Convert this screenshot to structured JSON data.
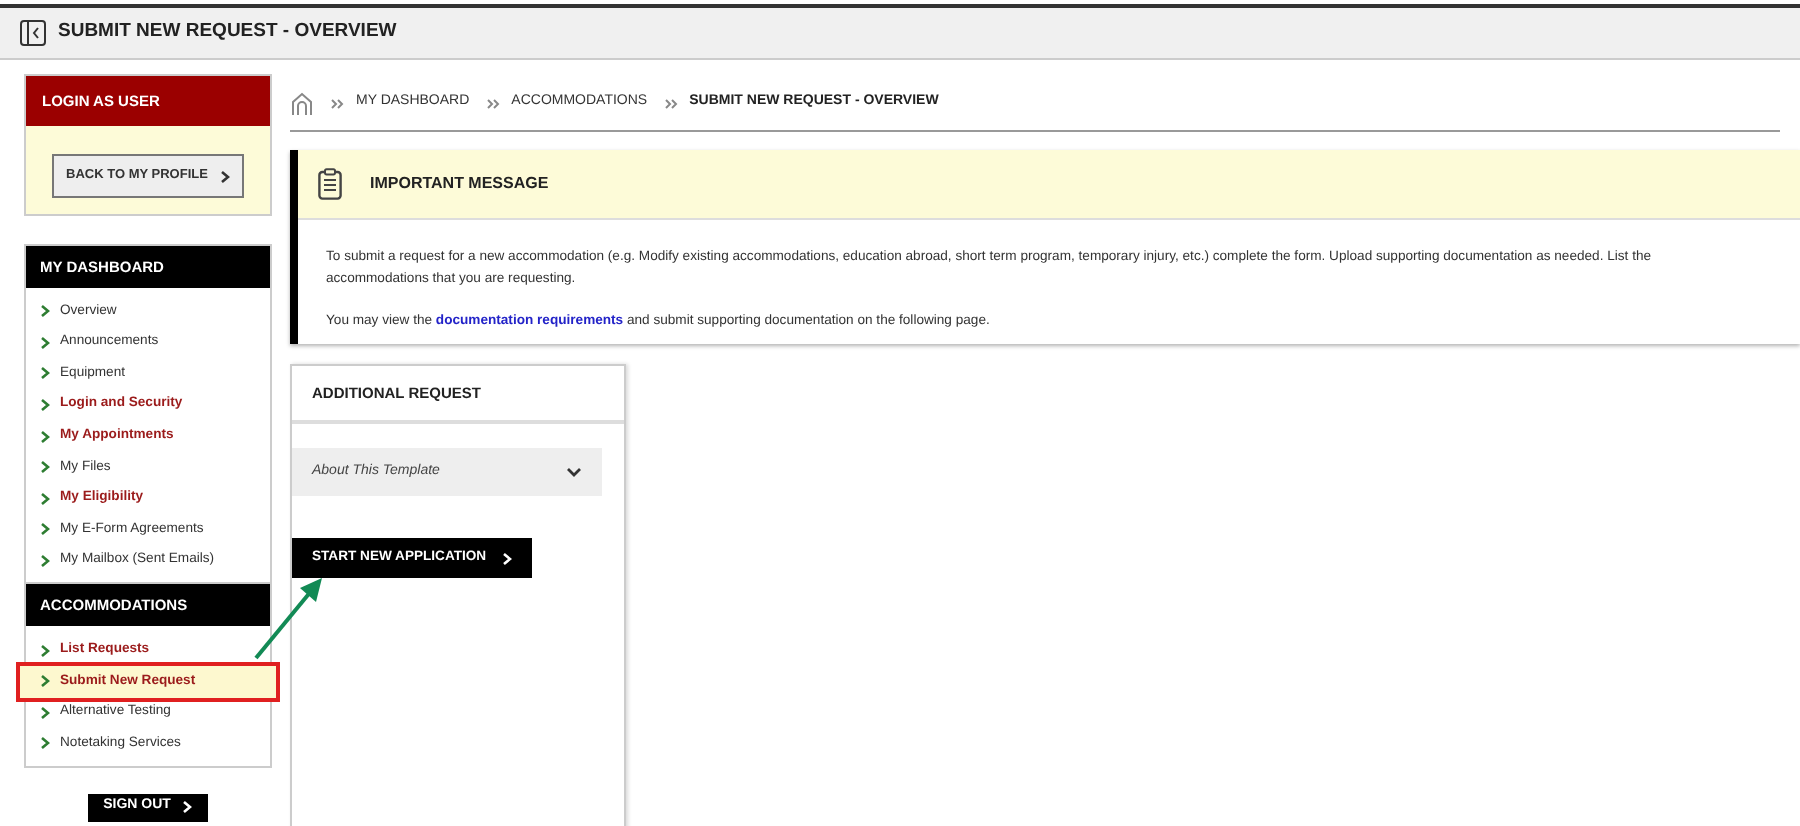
{
  "window": {
    "title": "SUBMIT NEW REQUEST - OVERVIEW"
  },
  "sidebar": {
    "login": {
      "title": "LOGIN AS USER",
      "button": "BACK TO MY PROFILE"
    },
    "sections": [
      {
        "title": "MY DASHBOARD",
        "items": [
          {
            "label": "Overview",
            "kind": "normal",
            "selected": false
          },
          {
            "label": "Announcements",
            "kind": "normal",
            "selected": false
          },
          {
            "label": "Equipment",
            "kind": "normal",
            "selected": false
          },
          {
            "label": "Login and Security",
            "kind": "emphasis",
            "selected": false
          },
          {
            "label": "My Appointments",
            "kind": "emphasis",
            "selected": false
          },
          {
            "label": "My Files",
            "kind": "normal",
            "selected": false
          },
          {
            "label": "My Eligibility",
            "kind": "emphasis",
            "selected": false
          },
          {
            "label": "My E-Form Agreements",
            "kind": "normal",
            "selected": false
          },
          {
            "label": "My Mailbox (Sent Emails)",
            "kind": "normal",
            "selected": false
          }
        ]
      },
      {
        "title": "ACCOMMODATIONS",
        "items": [
          {
            "label": "List Requests",
            "kind": "emphasis",
            "selected": false
          },
          {
            "label": "Submit New Request",
            "kind": "emphasis",
            "selected": true
          },
          {
            "label": "Alternative Testing",
            "kind": "normal",
            "selected": false
          },
          {
            "label": "Notetaking Services",
            "kind": "normal",
            "selected": false
          }
        ]
      }
    ],
    "sign_out": "SIGN OUT"
  },
  "breadcrumb": [
    "MY DASHBOARD",
    "ACCOMMODATIONS",
    "SUBMIT NEW REQUEST - OVERVIEW"
  ],
  "message": {
    "title": "IMPORTANT MESSAGE",
    "paragraph": "To submit a request for a new accommodation (e.g. Modify existing accommodations, education abroad, short term program, temporary injury, etc.) complete the form. Upload supporting documentation as needed. List the accommodations that you are requesting.",
    "second_before": "You may view the",
    "link": "documentation requirements",
    "second_after": "and submit supporting documentation on the following page."
  },
  "panel": {
    "title": "ADDITIONAL REQUEST",
    "accordion": {
      "label": "About This Template",
      "expanded": false
    },
    "button": "START NEW APPLICATION"
  }
}
